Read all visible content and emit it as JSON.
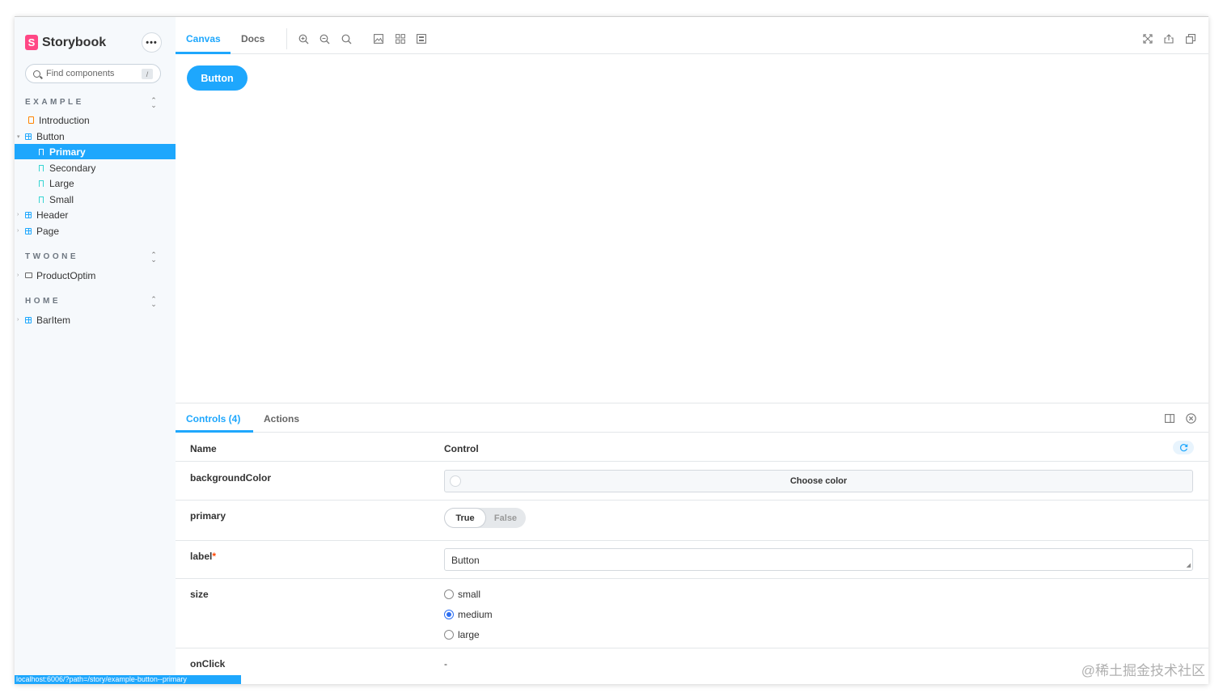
{
  "sidebar": {
    "brand": "Storybook",
    "logo_letter": "S",
    "menu_label": "•••",
    "search_placeholder": "Find components",
    "search_shortcut": "/",
    "groups": [
      {
        "title": "EXAMPLE"
      },
      {
        "title": "TWOONE"
      },
      {
        "title": "HOME"
      }
    ],
    "items": [
      {
        "label": "Introduction"
      },
      {
        "label": "Button"
      },
      {
        "label": "Primary"
      },
      {
        "label": "Secondary"
      },
      {
        "label": "Large"
      },
      {
        "label": "Small"
      },
      {
        "label": "Header"
      },
      {
        "label": "Page"
      },
      {
        "label": "ProductOptim"
      },
      {
        "label": "BarItem"
      }
    ]
  },
  "toolbar": {
    "tabs": [
      {
        "label": "Canvas"
      },
      {
        "label": "Docs"
      }
    ]
  },
  "canvas": {
    "button_label": "Button"
  },
  "panel": {
    "tabs": [
      {
        "label": "Controls (4)"
      },
      {
        "label": "Actions"
      }
    ],
    "head": {
      "name": "Name",
      "control": "Control"
    },
    "rows": {
      "backgroundColor": {
        "name": "backgroundColor",
        "control_label": "Choose color"
      },
      "primary": {
        "name": "primary",
        "true_label": "True",
        "false_label": "False"
      },
      "label": {
        "name": "label",
        "required_mark": "*",
        "value": "Button"
      },
      "size": {
        "name": "size",
        "options": [
          "small",
          "medium",
          "large"
        ],
        "selected": "medium"
      },
      "onClick": {
        "name": "onClick",
        "value": "-"
      }
    }
  },
  "status_url": "localhost:6006/?path=/story/example-button--primary",
  "watermark": "@稀土掘金技术社区",
  "colors": {
    "accent": "#1ea7fd",
    "brand": "#ff4785"
  }
}
